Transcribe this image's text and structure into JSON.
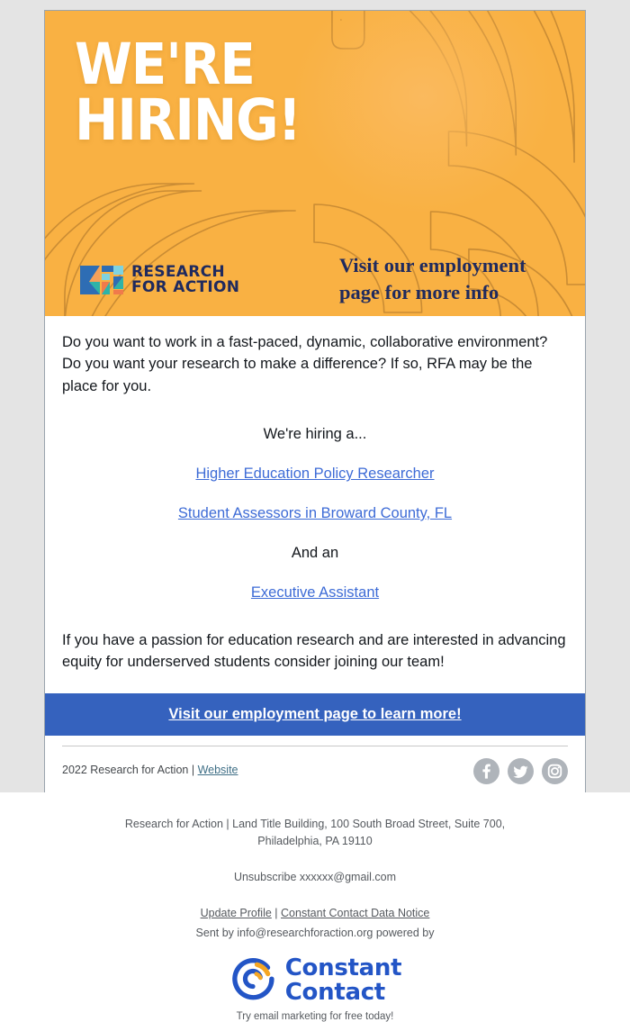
{
  "colors": {
    "hero_bg": "#f9b143",
    "hero_arc_stroke": "#c98b33",
    "navy": "#1f2a5e",
    "cta_bg": "#3562be",
    "link_blue": "#3d6bd6",
    "page_band": "#e4e4e4",
    "social_gray": "#afb4ba",
    "cc_blue": "#2355c6",
    "cc_orange": "#f5a623"
  },
  "hero": {
    "title": "WE'RE\nHIRING!",
    "tagline": "Visit our employment\npage for more info",
    "logo_mark_name": "rfa-logo-mark",
    "logo_words": "RESEARCH\nFOR ACTION"
  },
  "body": {
    "intro": "Do you want to work in a fast-paced, dynamic, collaborative environment? Do you want your research to make a difference? If so, RFA may be the place for you.",
    "hiring_lead": "We're hiring a...",
    "job_links": [
      "Higher Education Policy Researcher",
      "Student Assessors in Broward County, FL"
    ],
    "and_an": "And an",
    "job_link_last": "Executive Assistant",
    "outro": "If you have a passion for education research and are interested in advancing equity for underserved students consider joining our team!"
  },
  "cta": {
    "label": "Visit our employment page to learn more!"
  },
  "card_footer": {
    "copyright": "2022 Research for Action |",
    "website_label": "Website",
    "social": [
      {
        "name": "facebook-icon",
        "label": "Facebook"
      },
      {
        "name": "twitter-icon",
        "label": "Twitter"
      },
      {
        "name": "instagram-icon",
        "label": "Instagram"
      }
    ]
  },
  "page_footer": {
    "address": "Research for Action | Land Title Building, 100 South Broad Street, Suite 700,\nPhiladelphia, PA 19110",
    "unsubscribe": "Unsubscribe xxxxxx@gmail.com",
    "update_profile": "Update Profile",
    "separator": " | ",
    "data_notice": "Constant Contact Data Notice",
    "sent_by": "Sent by info@researchforaction.org powered by",
    "cc_logo_name": "constant-contact-logo",
    "cc_logo_words": "Constant\nContact",
    "cc_tagline": "Try email marketing for free today!"
  }
}
